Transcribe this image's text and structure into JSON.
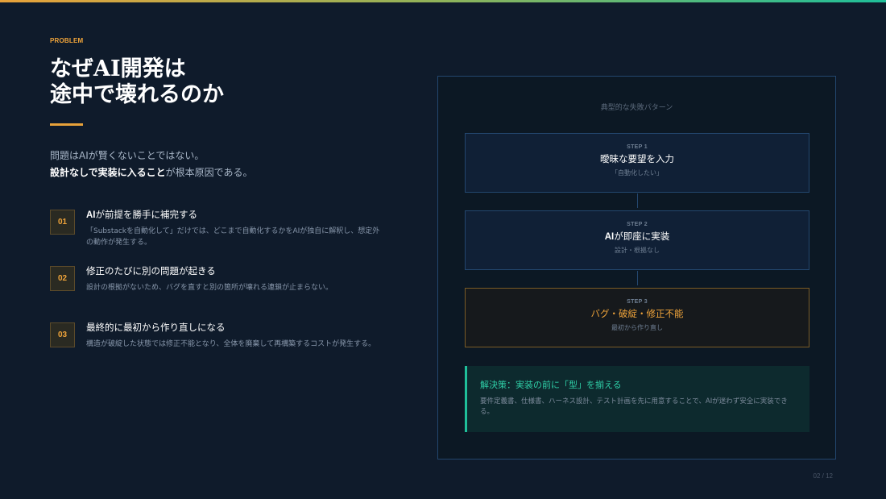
{
  "slide": {
    "eyebrow": "PROBLEM",
    "title_line1": "なぜAI開発は",
    "title_line2": "途中で壊れるのか",
    "lead_line1": "問題はAIが賢くないことではない。",
    "lead_line2_strong": "設計なしで実装に入ること",
    "lead_line2_rest": "が根本原因である。"
  },
  "items": [
    {
      "num": "01",
      "title_strong": "AI",
      "title_rest": "が前提を勝手に補完する",
      "desc": "「Substackを自動化して」だけでは、どこまで自動化するかをAIが独自に解釈し、想定外の動作が発生する。"
    },
    {
      "num": "02",
      "title_strong": "",
      "title_rest": "修正のたびに別の問題が起きる",
      "desc": "設計の根拠がないため、バグを直すと別の箇所が壊れる連鎖が止まらない。"
    },
    {
      "num": "03",
      "title_strong": "",
      "title_rest": "最終的に最初から作り直しになる",
      "desc": "構造が破綻した状態では修正不能となり、全体を廃棄して再構築するコストが発生する。"
    }
  ],
  "panel": {
    "caption": "典型的な失敗パターン",
    "steps": [
      {
        "label": "STEP 1",
        "title_strong": "",
        "title_rest": "曖昧な要望を入力",
        "sub": "「自動化したい」"
      },
      {
        "label": "STEP 2",
        "title_strong": "AI",
        "title_rest": "が即座に実装",
        "sub": "設計・根拠なし"
      },
      {
        "label": "STEP 3",
        "title_strong": "",
        "title_rest": "バグ・破綻・修正不能",
        "sub": "最初から作り直し"
      }
    ],
    "solution_title": "解決策：実装の前に「型」を揃える",
    "solution_desc": "要件定義書、仕様書、ハーネス設計、テスト計画を先に用意することで、AIが迷わず安全に実装できる。"
  },
  "pager": "02 / 12",
  "colors": {
    "background": "#0f1b2b",
    "accent_orange": "#f0a43a",
    "accent_teal": "#1fbf9a",
    "panel_border": "#23466e"
  }
}
